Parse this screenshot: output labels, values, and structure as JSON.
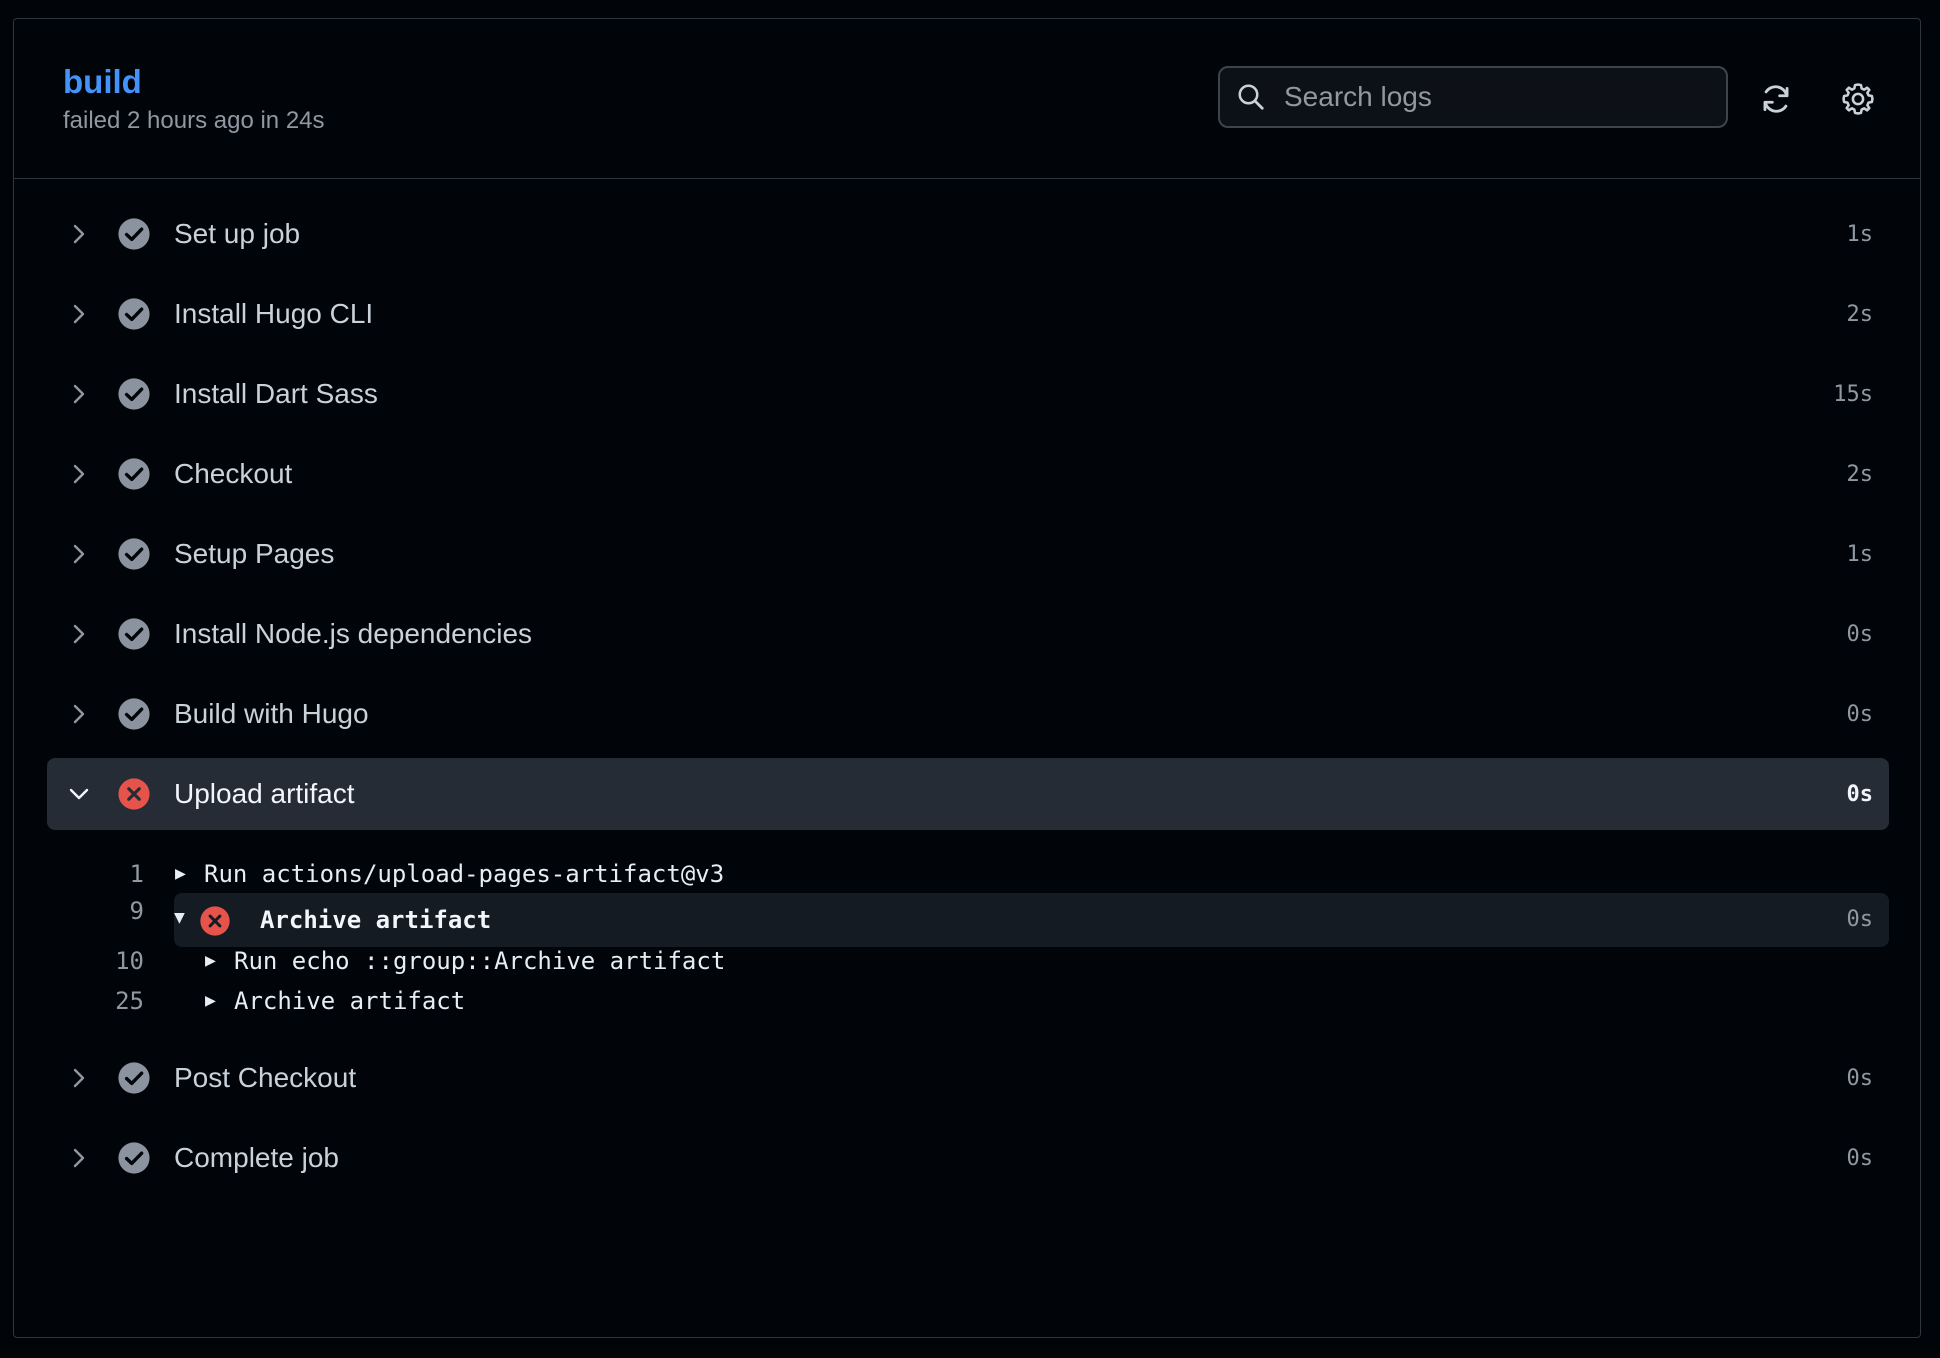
{
  "header": {
    "job_name": "build",
    "job_status": "failed 2 hours ago in 24s",
    "search_placeholder": "Search logs",
    "icons": [
      "search-icon",
      "refresh-icon",
      "gear-icon"
    ]
  },
  "colors": {
    "success": "#8b949e",
    "failure": "#e5534b",
    "link": "#4493f8",
    "active_row": "#262c36"
  },
  "steps": [
    {
      "name": "Set up job",
      "duration": "1s",
      "status": "success"
    },
    {
      "name": "Install Hugo CLI",
      "duration": "2s",
      "status": "success"
    },
    {
      "name": "Install Dart Sass",
      "duration": "15s",
      "status": "success"
    },
    {
      "name": "Checkout",
      "duration": "2s",
      "status": "success"
    },
    {
      "name": "Setup Pages",
      "duration": "1s",
      "status": "success"
    },
    {
      "name": "Install Node.js dependencies",
      "duration": "0s",
      "status": "success"
    },
    {
      "name": "Build with Hugo",
      "duration": "0s",
      "status": "success"
    },
    {
      "name": "Upload artifact",
      "duration": "0s",
      "status": "failure",
      "expanded": true
    },
    {
      "name": "Post Checkout",
      "duration": "0s",
      "status": "success"
    },
    {
      "name": "Complete job",
      "duration": "0s",
      "status": "success"
    }
  ],
  "log": {
    "lines": [
      {
        "num": "1",
        "text": "Run actions/upload-pages-artifact@v3"
      },
      {
        "num": "9",
        "text": "Archive artifact",
        "duration": "0s",
        "status": "failure"
      },
      {
        "num": "10",
        "text": "Run echo ::group::Archive artifact"
      },
      {
        "num": "25",
        "text": "Archive artifact"
      }
    ]
  }
}
